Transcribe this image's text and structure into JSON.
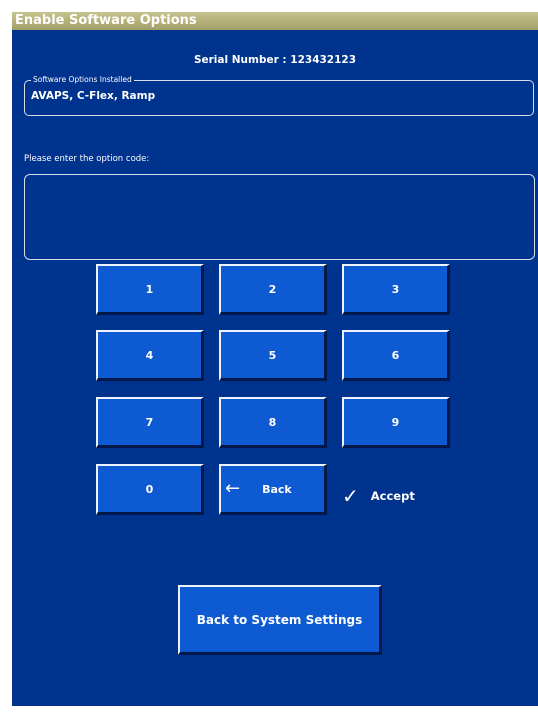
{
  "title": "Enable Software Options",
  "serial": {
    "label": "Serial Number :",
    "value": "123432123"
  },
  "installed": {
    "legend": "Software Options Installed",
    "value": "AVAPS, C-Flex, Ramp"
  },
  "code_prompt": "Please enter the option code:",
  "code_value": "",
  "keypad": {
    "k1": "1",
    "k2": "2",
    "k3": "3",
    "k4": "4",
    "k5": "5",
    "k6": "6",
    "k7": "7",
    "k8": "8",
    "k9": "9",
    "k0": "0",
    "back_label": "Back",
    "accept_label": "Accept"
  },
  "back_to_settings_label": "Back to System Settings",
  "icons": {
    "back": "left-arrow-icon",
    "accept": "checkmark-icon"
  },
  "colors": {
    "background": "#00338e",
    "button": "#0d5ad2",
    "titlebar": "#b5b17a"
  }
}
